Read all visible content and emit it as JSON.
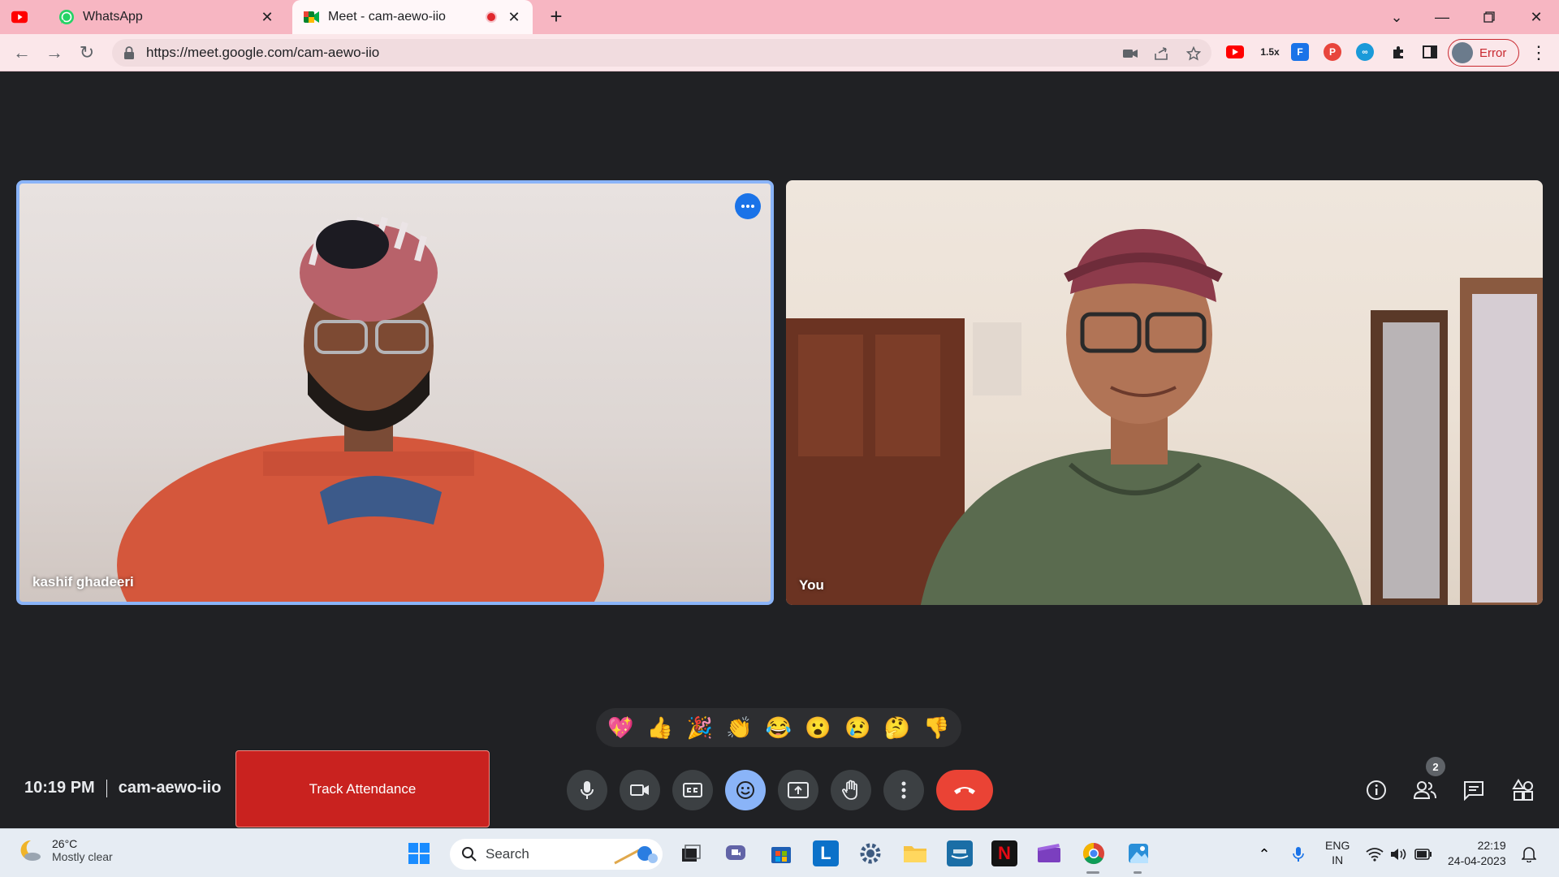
{
  "browser": {
    "tabs": [
      {
        "label": "WhatsApp"
      },
      {
        "label": "Meet - cam-aewo-iio"
      }
    ],
    "url": "https://meet.google.com/cam-aewo-iio",
    "zoom_ext": "1.5x",
    "profile_status": "Error"
  },
  "meeting": {
    "participants": [
      {
        "name": "kashif ghadeeri"
      },
      {
        "name": "You"
      }
    ],
    "reactions": [
      "💖",
      "👍",
      "🎉",
      "👏",
      "😂",
      "😮",
      "😢",
      "🤔",
      "👎"
    ],
    "time": "10:19 PM",
    "code": "cam-aewo-iio",
    "track_attendance": "Track Attendance",
    "participant_count": "2"
  },
  "taskbar": {
    "weather_temp": "26°C",
    "weather_desc": "Mostly clear",
    "search": "Search",
    "lang_1": "ENG",
    "lang_2": "IN",
    "clock_time": "22:19",
    "clock_date": "24-04-2023"
  },
  "colors": {
    "tab_strip": "#f7b6c2",
    "meet_bg": "#202124",
    "active_tile_border": "#8ab4f8",
    "end_call": "#ea4335",
    "track_button": "#c9221f"
  }
}
